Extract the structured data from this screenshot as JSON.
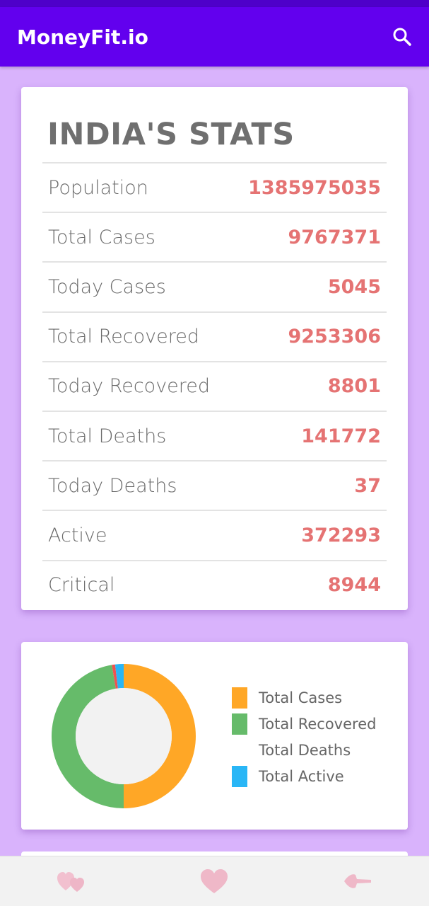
{
  "appbar": {
    "title": "MoneyFit.io",
    "search_icon": "search-icon"
  },
  "stats": {
    "title": "INDIA'S STATS",
    "rows": [
      {
        "label": "Population",
        "value": "1385975035"
      },
      {
        "label": "Total Cases",
        "value": "9767371"
      },
      {
        "label": "Today Cases",
        "value": "5045"
      },
      {
        "label": "Total Recovered",
        "value": "9253306"
      },
      {
        "label": "Today Recovered",
        "value": "8801"
      },
      {
        "label": "Total Deaths",
        "value": "141772"
      },
      {
        "label": "Today Deaths",
        "value": "37"
      },
      {
        "label": "Active",
        "value": "372293"
      },
      {
        "label": "Critical",
        "value": "8944"
      }
    ]
  },
  "chart_data": {
    "type": "pie",
    "title": "",
    "series": [
      {
        "name": "Total Cases",
        "value": 9767371,
        "color": "#ffa726"
      },
      {
        "name": "Total Recovered",
        "value": 9253306,
        "color": "#66bb6a"
      },
      {
        "name": "Total Deaths",
        "value": 141772,
        "color": "#ef5350"
      },
      {
        "name": "Total Active",
        "value": 372293,
        "color": "#29b6f6"
      }
    ],
    "legend_position": "right"
  },
  "legend": {
    "items": [
      {
        "label": "Total Cases",
        "color": "#ffa726",
        "show_swatch": true
      },
      {
        "label": "Total Recovered",
        "color": "#66bb6a",
        "show_swatch": true
      },
      {
        "label": "Total Deaths",
        "color": "#ffffff",
        "show_swatch": false
      },
      {
        "label": "Total Active",
        "color": "#29b6f6",
        "show_swatch": true
      }
    ]
  },
  "bottom_nav": {
    "items": [
      {
        "icon": "hearts-icon"
      },
      {
        "icon": "heart-icon"
      },
      {
        "icon": "back-arrow-icon"
      }
    ]
  },
  "colors": {
    "appbar": "#6200ee",
    "background": "#d9b3fc",
    "value_text": "#e57373"
  }
}
